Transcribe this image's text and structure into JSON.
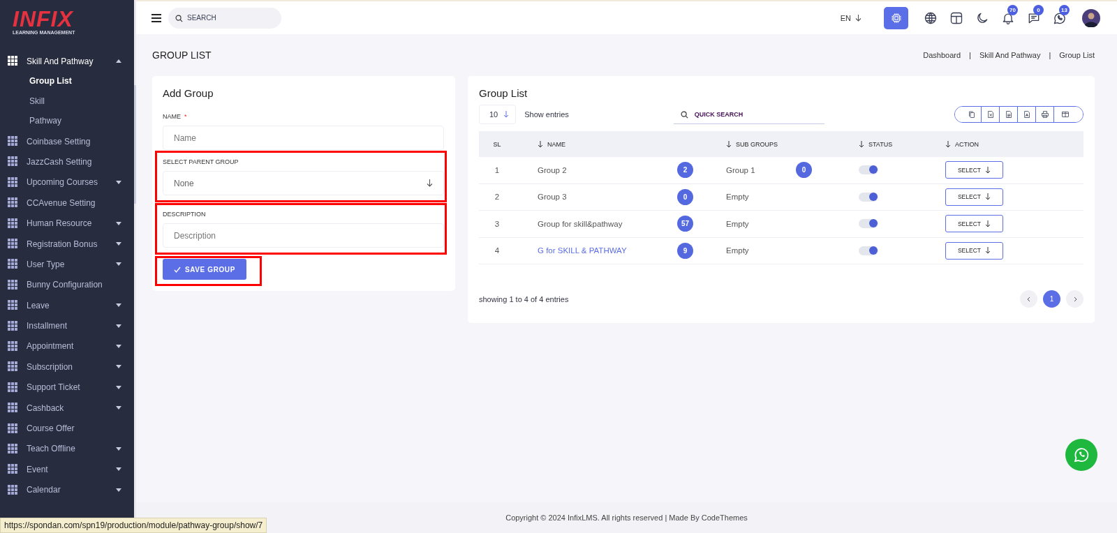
{
  "logo": {
    "title": "INFIX",
    "subtitle": "LEARNING MANAGEMENT"
  },
  "sidebar": {
    "items": [
      {
        "label": "Skill And Pathway",
        "kind": "dropdown",
        "expanded": true,
        "children": [
          {
            "label": "Group List",
            "selected": true
          },
          {
            "label": "Skill",
            "selected": false
          },
          {
            "label": "Pathway",
            "selected": false
          }
        ]
      },
      {
        "label": "Coinbase Setting",
        "kind": "link",
        "expanded": false
      },
      {
        "label": "JazzCash Setting",
        "kind": "link",
        "expanded": false
      },
      {
        "label": "Upcoming Courses",
        "kind": "dropdown",
        "expanded": false
      },
      {
        "label": "CCAvenue Setting",
        "kind": "link",
        "expanded": false
      },
      {
        "label": "Human Resource",
        "kind": "dropdown",
        "expanded": false
      },
      {
        "label": "Registration Bonus",
        "kind": "dropdown",
        "expanded": false
      },
      {
        "label": "User Type",
        "kind": "dropdown",
        "expanded": false
      },
      {
        "label": "Bunny Configuration",
        "kind": "link",
        "expanded": false
      },
      {
        "label": "Leave",
        "kind": "dropdown",
        "expanded": false
      },
      {
        "label": "Installment",
        "kind": "dropdown",
        "expanded": false
      },
      {
        "label": "Appointment",
        "kind": "dropdown",
        "expanded": false
      },
      {
        "label": "Subscription",
        "kind": "dropdown",
        "expanded": false
      },
      {
        "label": "Support Ticket",
        "kind": "dropdown",
        "expanded": false
      },
      {
        "label": "Cashback",
        "kind": "dropdown",
        "expanded": false
      },
      {
        "label": "Course Offer",
        "kind": "link",
        "expanded": false
      },
      {
        "label": "Teach Offline",
        "kind": "dropdown",
        "expanded": false
      },
      {
        "label": "Event",
        "kind": "dropdown",
        "expanded": false
      },
      {
        "label": "Calendar",
        "kind": "dropdown",
        "expanded": false
      }
    ]
  },
  "topbar": {
    "search": {
      "placeholder": "SEARCH"
    },
    "language": "EN",
    "badges": {
      "notifications": "70",
      "messages": "0",
      "chats": "13"
    }
  },
  "page": {
    "title": "GROUP LIST",
    "breadcrumb": [
      "Dashboard",
      "Skill And Pathway",
      "Group List"
    ],
    "breadcrumb_separator": "|"
  },
  "add_group": {
    "title": "Add Group",
    "fields": [
      {
        "label": "NAME",
        "required_mark": "*",
        "kind": "input",
        "placeholder": "Name",
        "highlighted": false
      },
      {
        "label": "SELECT PARENT GROUP",
        "kind": "select",
        "value": "None",
        "highlighted": true
      },
      {
        "label": "DESCRIPTION",
        "kind": "input",
        "placeholder": "Description",
        "highlighted": true
      }
    ],
    "save_button": {
      "label": "SAVE GROUP",
      "highlighted": true
    }
  },
  "group_list": {
    "title": "Group List",
    "page_size": "10",
    "show_entries": "Show entries",
    "search": {
      "placeholder": "QUICK SEARCH"
    },
    "columns": [
      "SL",
      "NAME",
      "SUB GROUPS",
      "STATUS",
      "ACTION"
    ],
    "rows": [
      {
        "sl": "1",
        "name": "Group 2",
        "linked": false,
        "count": "2",
        "sub_group": "Group 1",
        "sub_count": "0",
        "on": true,
        "action": "SELECT"
      },
      {
        "sl": "2",
        "name": "Group 3",
        "linked": false,
        "count": "0",
        "sub_group": "Empty",
        "on": true,
        "action": "SELECT"
      },
      {
        "sl": "3",
        "name": "Group for skill&pathway",
        "linked": false,
        "count": "57",
        "sub_group": "Empty",
        "on": true,
        "action": "SELECT"
      },
      {
        "sl": "4",
        "name": "G for SKILL & PATHWAY",
        "linked": true,
        "count": "9",
        "sub_group": "Empty",
        "on": true,
        "action": "SELECT"
      }
    ],
    "summary": "showing 1 to 4 of 4 entries",
    "pages": [
      {
        "label": "1",
        "selected": true
      }
    ]
  },
  "footer": "Copyright © 2024 InfixLMS. All rights reserved | Made By CodeThemes",
  "status_bar": "https://spondan.com/spn19/production/module/pathway-group/show/7"
}
